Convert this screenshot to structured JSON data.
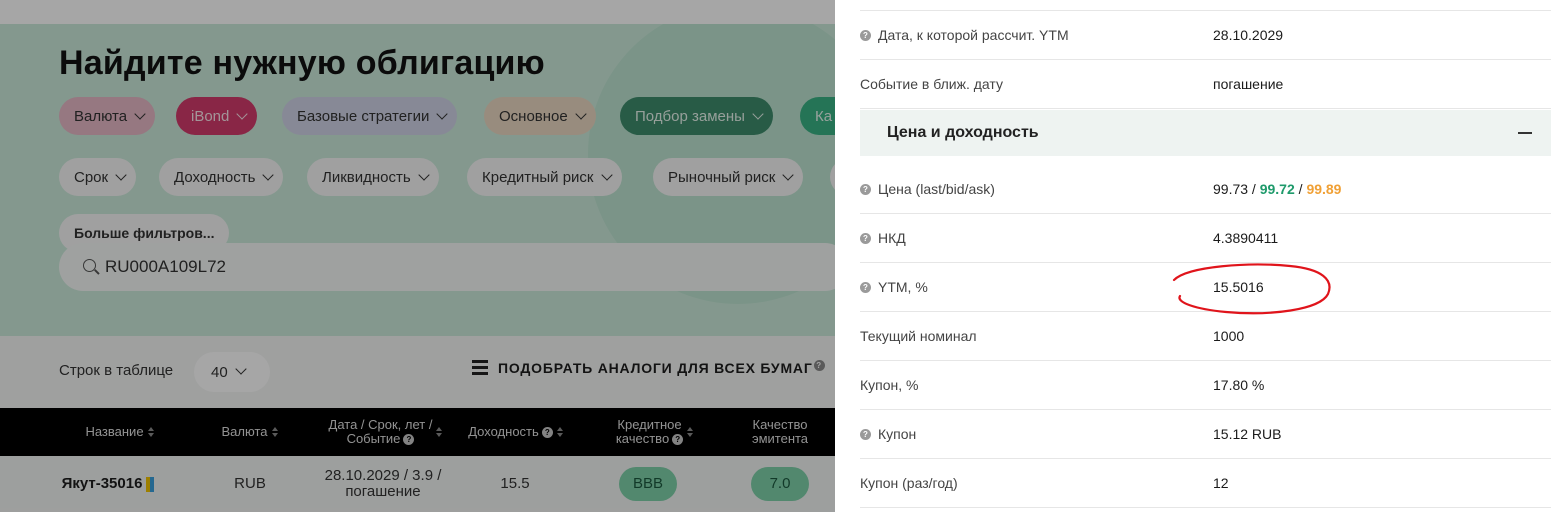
{
  "left": {
    "title": "Найдите нужную облигацию",
    "filters_row1": [
      "Валюта",
      "iBond",
      "Базовые стратегии",
      "Основное",
      "Подбор замены",
      "Ка"
    ],
    "filters_row2": [
      "Срок",
      "Доходность",
      "Ликвидность",
      "Кредитный риск",
      "Рыночный риск"
    ],
    "more_filters": "Больше фильтров...",
    "search": {
      "value": "RU000A109L72"
    },
    "rows_label": "Строк в таблице",
    "rows_value": "40",
    "analogs_button": "ПОДОБРАТЬ АНАЛОГИ ДЛЯ ВСЕХ БУМАГ",
    "table": {
      "headers": {
        "name": "Название",
        "currency": "Валюта",
        "date_line1": "Дата / Срок, лет /",
        "date_line2": "Событие",
        "yield": "Доходность",
        "credit_line1": "Кредитное",
        "credit_line2": "качество",
        "issuer_line1": "Качество",
        "issuer_line2": "эмитента"
      },
      "row": {
        "name": "Якут-35016",
        "currency": "RUB",
        "date_line1": "28.10.2029 / 3.9 /",
        "date_line2": "погашение",
        "yield": "15.5",
        "credit": "BBB",
        "issuer": "7.0"
      }
    }
  },
  "panel": {
    "rows_top": [
      {
        "label": "Дата, к которой рассчит. YTM",
        "value": "28.10.2029",
        "help": true
      },
      {
        "label": "Событие в ближ. дату",
        "value": "погашение",
        "help": false
      }
    ],
    "section_title": "Цена и доходность",
    "price": {
      "label": "Цена (last/bid/ask)",
      "last": "99.73",
      "sep": " / ",
      "bid": "99.72",
      "ask": "99.89"
    },
    "rows_bottom": [
      {
        "label": "НКД",
        "value": "4.3890411",
        "help": true
      },
      {
        "label": "YTM, %",
        "value": "15.5016",
        "help": true
      },
      {
        "label": "Текущий номинал",
        "value": "1000",
        "help": false
      },
      {
        "label": "Купон, %",
        "value": "17.80 %",
        "help": false
      },
      {
        "label": "Купон",
        "value": "15.12 RUB",
        "help": true
      },
      {
        "label": "Купон (раз/год)",
        "value": "12",
        "help": false
      }
    ]
  },
  "colors": {
    "bid": "#1e9a6b",
    "ask": "#f0a035",
    "annotation": "#e0141b",
    "hero": "#cbeadb"
  }
}
